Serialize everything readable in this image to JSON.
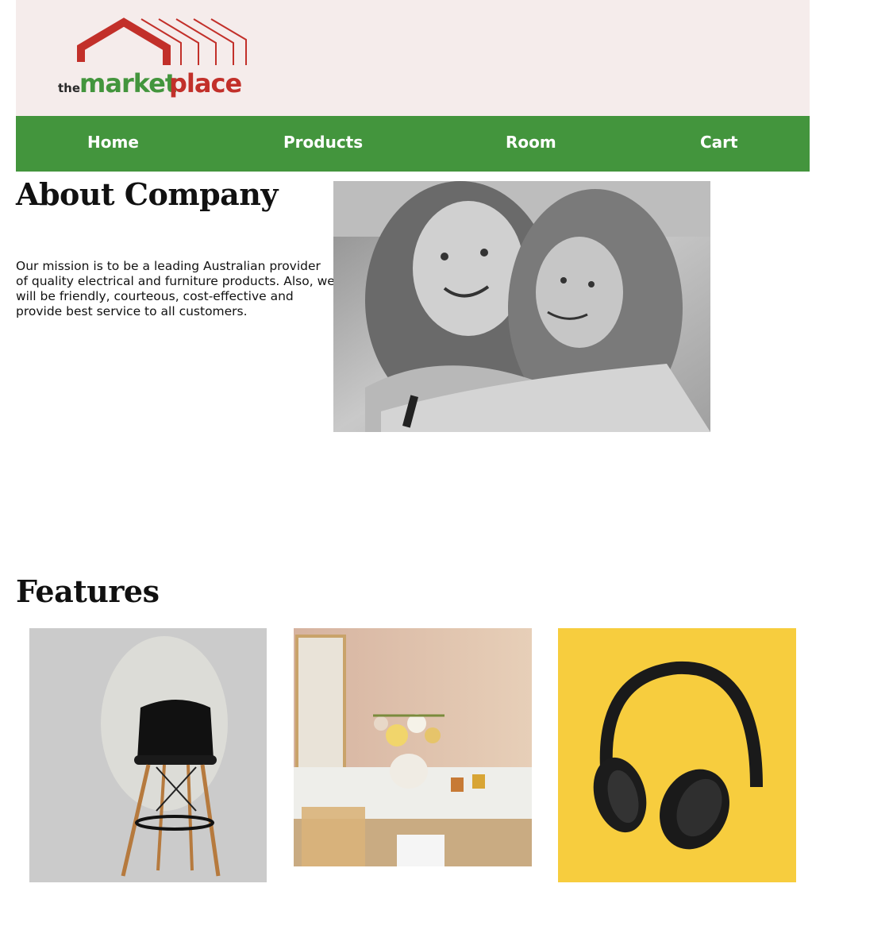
{
  "header": {
    "logo": {
      "prefix": "the",
      "word1": "market",
      "word2": "place",
      "colors": {
        "red": "#c2302a",
        "green": "#43953d",
        "dark": "#2a2a2a"
      }
    },
    "background": "#f5eceb"
  },
  "nav": {
    "background": "#43953d",
    "items": [
      {
        "label": "Home"
      },
      {
        "label": "Products"
      },
      {
        "label": "Room"
      },
      {
        "label": "Cart"
      }
    ]
  },
  "about": {
    "title": "About Company",
    "text": "Our mission is to be a leading Australian provider of quality electrical and furniture products. Also, we will be friendly, courteous, cost-effective and provide best service to all customers.",
    "image": "black-and-white-photo-two-girls-hugging"
  },
  "features": {
    "title": "Features",
    "items": [
      {
        "image": "black-chair-stool"
      },
      {
        "image": "dining-table-flowers"
      },
      {
        "image": "headphones-on-yellow"
      }
    ]
  }
}
